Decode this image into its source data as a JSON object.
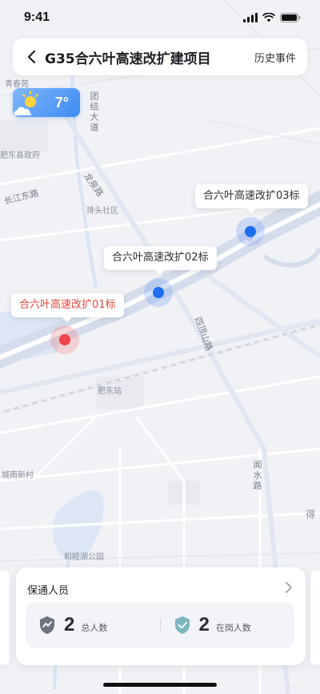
{
  "status_bar": {
    "time": "9:41"
  },
  "header": {
    "title": "G35合六叶高速改扩建项目",
    "history_label": "历史事件"
  },
  "weather": {
    "temperature": "7°",
    "icon": "partly-cloudy-icon"
  },
  "map": {
    "labels": {
      "qingchunyuan": "青春苑",
      "tuanjie_road": "团结大道",
      "feidong_gov": "肥东县政府",
      "changjiang_road": "长江东路",
      "longquan_road": "龙泉路",
      "paitou": "排头社区",
      "sidingshan_road": "四顶山路",
      "feidong_station": "肥东站",
      "chengnan": "城南新村",
      "wenshui_road": "闻水路",
      "hehu_park": "和睦湖公园",
      "de": "得"
    }
  },
  "markers": [
    {
      "label": "合六叶高速改扩03标",
      "status": "normal"
    },
    {
      "label": "合六叶高速改扩02标",
      "status": "normal"
    },
    {
      "label": "合六叶高速改扩01标",
      "status": "alert"
    }
  ],
  "personnel_card": {
    "title": "保通人员",
    "stats": [
      {
        "icon": "trend-shield-icon",
        "value": "2",
        "label": "总人数"
      },
      {
        "icon": "check-shield-icon",
        "value": "2",
        "label": "在岗人数"
      }
    ]
  },
  "colors": {
    "accent": "#1d6ef0",
    "alert": "#e8443d"
  }
}
